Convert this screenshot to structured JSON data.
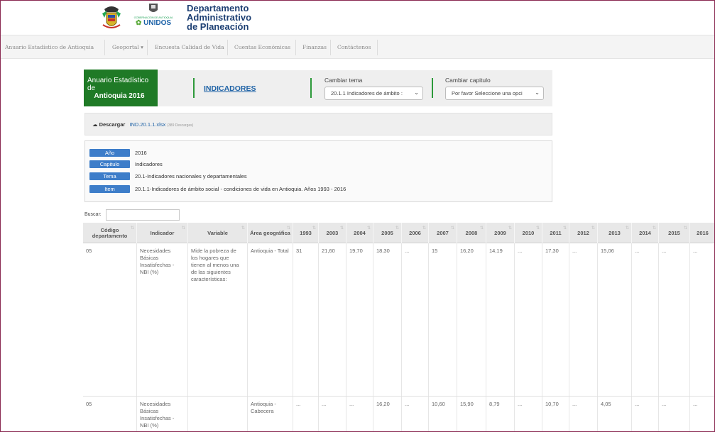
{
  "header": {
    "gov_mini": "GOBERNACIÓN DE ANTIOQUIA",
    "gov_unidos": "UNIDOS",
    "dept_line1": "Departamento",
    "dept_line2": "Administrativo",
    "dept_line3": "de Planeación"
  },
  "nav": {
    "items": [
      {
        "label": "Anuario Estadístico de Antioquia"
      },
      {
        "label": "Geoportal ▾"
      },
      {
        "label": "Encuesta Calidad de Vida"
      },
      {
        "label": "Cuentas Económicas"
      },
      {
        "label": "Finanzas"
      },
      {
        "label": "Contáctenos"
      }
    ]
  },
  "brand": {
    "line1": "Anuario Estadístico de",
    "line2": "Antioquia 2016"
  },
  "tabs": {
    "indicadores": "INDICADORES"
  },
  "theme_select": {
    "label": "Cambiar tema",
    "value": "20.1.1 Indicadores de ámbito :"
  },
  "chapter_select": {
    "label": "Cambiar capitulo",
    "value": "Por favor Seleccione una opci"
  },
  "download": {
    "label": "Descargar",
    "file": "IND.20.1.1.xlsx",
    "count": "(389 Descargas)"
  },
  "info": {
    "rows": [
      {
        "key": "Año",
        "value": "2016"
      },
      {
        "key": "Capitulo",
        "value": "Indicadores"
      },
      {
        "key": "Tema",
        "value": "20.1-Indicadores nacionales y departamentales"
      },
      {
        "key": "Item",
        "value": "20.1.1-Indicadores de ámbito social - condiciones de vida en Antioquia. Años 1993 - 2016"
      }
    ]
  },
  "search": {
    "label": "Buscar:",
    "value": ""
  },
  "table": {
    "headers": [
      "Código departamento",
      "Indicador",
      "Variable",
      "Área geográfica",
      "1993",
      "2003",
      "2004",
      "2005",
      "2006",
      "2007",
      "2008",
      "2009",
      "2010",
      "2011",
      "2012",
      "2013",
      "2014",
      "2015",
      "2016"
    ],
    "rows": [
      [
        "05",
        "Necesidades Básicas Insatisfechas - NBI (%)",
        "Mide la pobreza de los hogares que tienen al menos una de las siguientes características:",
        "Antioquia - Total",
        "31",
        "21,60",
        "19,70",
        "18,30",
        "...",
        "15",
        "16,20",
        "14,19",
        "...",
        "17,30",
        "...",
        "15,06",
        "...",
        "...",
        "..."
      ],
      [
        "05",
        "Necesidades Básicas Insatisfechas - NBI (%)",
        "",
        "Antioquia - Cabecera",
        "...",
        "...",
        "...",
        "16,20",
        "...",
        "10,60",
        "15,90",
        "8,79",
        "...",
        "10,70",
        "...",
        "4,05",
        "...",
        "...",
        "..."
      ]
    ]
  },
  "colors": {
    "brand_green": "#1f7a26",
    "accent_green": "#2d9a3a",
    "pill_blue": "#3d7dc9",
    "link_blue": "#1f63a6",
    "title_blue": "#1d3f73",
    "frame": "#8a2a52"
  },
  "icons": {
    "download": "cloud-download-icon",
    "sort": "sort-icon",
    "chevron": "chevron-down-icon"
  }
}
